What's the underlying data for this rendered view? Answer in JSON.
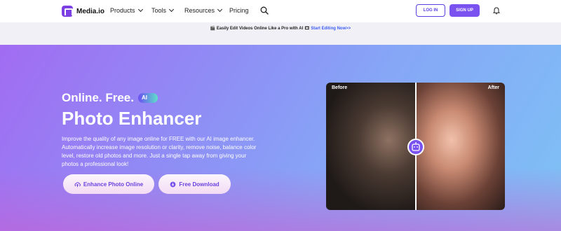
{
  "nav": {
    "logo_text": "Media.io",
    "items": [
      {
        "label": "Products"
      },
      {
        "label": "Tools"
      },
      {
        "label": "Resources"
      },
      {
        "label": "Pricing"
      }
    ],
    "login_label": "LOG IN",
    "signup_label": "SIGN UP"
  },
  "banner": {
    "text": "Easily Edit Videos Online Like a Pro with AI",
    "link": "Start Editing Now>>"
  },
  "hero": {
    "eyebrow": "Online. Free.",
    "ai_badge": "AI",
    "title": "Photo Enhancer",
    "description": "Improve the quality of any image online for FREE with our AI image enhancer. Automatically increase image resolution or clarity, remove noise, balance color level, restore old photos and more. Just a single tap away from giving your photos a professional look!",
    "cta_primary": "Enhance Photo Online",
    "cta_secondary": "Free Download",
    "before_label": "Before",
    "after_label": "After"
  },
  "colors": {
    "accent": "#7a52f0",
    "link": "#3d5cf5"
  }
}
